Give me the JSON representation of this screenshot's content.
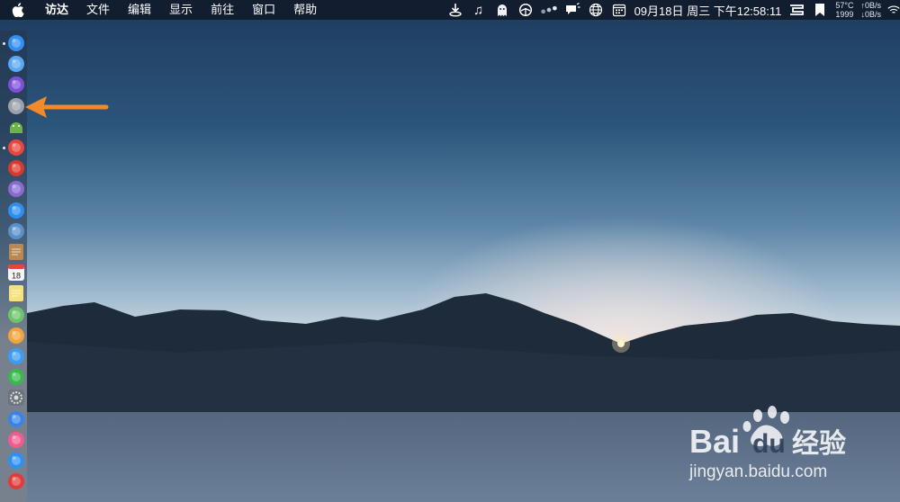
{
  "menubar": {
    "apple_icon": "apple-icon",
    "app_name": "访达",
    "menus": [
      "文件",
      "编辑",
      "显示",
      "前往",
      "窗口",
      "帮助"
    ],
    "status": {
      "icons": [
        "download-icon",
        "music-note-icon",
        "ghost-icon",
        "network-icon",
        "dots-icon",
        "notification-icon",
        "globe-icon",
        "calendar-icon"
      ],
      "datetime": "09月18日 周三 下午12:58:11",
      "cpu_temp": "57°C",
      "fan_rpm": "1999",
      "net_up": "↑0B/s",
      "net_down": "↓0B/s"
    }
  },
  "dock": {
    "items": [
      {
        "name": "finder",
        "color": "#2f8ff5",
        "running": true
      },
      {
        "name": "safari-alt",
        "color": "#5aa7f5",
        "running": false
      },
      {
        "name": "siri",
        "color": "#7f4fd8",
        "running": false
      },
      {
        "name": "launchpad",
        "color": "#9aa1aa",
        "running": false
      },
      {
        "name": "android-studio",
        "color": "#6bb34a",
        "running": false
      },
      {
        "name": "chrome",
        "color": "#e8453c",
        "running": true
      },
      {
        "name": "app-red",
        "color": "#d8392f",
        "running": false
      },
      {
        "name": "app-purple",
        "color": "#8a6ad0",
        "running": false
      },
      {
        "name": "safari",
        "color": "#2e8ef0",
        "running": false
      },
      {
        "name": "preview",
        "color": "#5b8fc9",
        "running": false
      },
      {
        "name": "notes-brown",
        "color": "#b88a52",
        "running": false
      },
      {
        "name": "calendar",
        "color": "#f5f5f5",
        "running": false
      },
      {
        "name": "notes",
        "color": "#f6e27a",
        "running": false
      },
      {
        "name": "maps",
        "color": "#6cc46a",
        "running": false
      },
      {
        "name": "photos",
        "color": "#f0a43a",
        "running": false
      },
      {
        "name": "messages",
        "color": "#3b9cf0",
        "running": false
      },
      {
        "name": "facetime",
        "color": "#39b84d",
        "running": false
      },
      {
        "name": "system-preferences",
        "color": "#8d949c",
        "running": false
      },
      {
        "name": "keynote",
        "color": "#3a83e6",
        "running": false
      },
      {
        "name": "itunes",
        "color": "#f05a8e",
        "running": false
      },
      {
        "name": "app-store",
        "color": "#2f8ff5",
        "running": false
      },
      {
        "name": "vivaldi",
        "color": "#e03c3c",
        "running": false
      }
    ],
    "calendar_day": "18"
  },
  "annotation": {
    "arrow_color": "#f28a2c"
  },
  "watermark": {
    "brand_left": "Bai",
    "brand_right": "du",
    "brand_cn": "经验",
    "url": "jingyan.baidu.com"
  }
}
